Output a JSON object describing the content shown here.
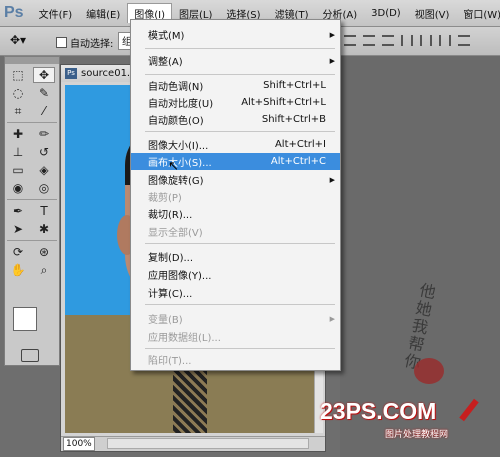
{
  "app": {
    "logo": "Ps"
  },
  "menubar": {
    "items": [
      "文件(F)",
      "编辑(E)",
      "图像(I)",
      "图层(L)",
      "选择(S)",
      "滤镜(T)",
      "分析(A)",
      "3D(D)",
      "视图(V)",
      "窗口(W)"
    ],
    "active": "图像(I)"
  },
  "options": {
    "auto_select_label": "自动选择:",
    "auto_select_value": "组"
  },
  "document": {
    "title": "source01.jp",
    "zoom": "100%"
  },
  "image_menu": {
    "items": [
      {
        "label": "模式(M)",
        "shortcut": "",
        "submenu": true,
        "disabled": false
      },
      {
        "label": "调整(A)",
        "shortcut": "",
        "submenu": true,
        "disabled": false
      },
      {
        "label": "自动色调(N)",
        "shortcut": "Shift+Ctrl+L",
        "submenu": false,
        "disabled": false
      },
      {
        "label": "自动对比度(U)",
        "shortcut": "Alt+Shift+Ctrl+L",
        "submenu": false,
        "disabled": false
      },
      {
        "label": "自动颜色(O)",
        "shortcut": "Shift+Ctrl+B",
        "submenu": false,
        "disabled": false
      },
      {
        "label": "图像大小(I)...",
        "shortcut": "Alt+Ctrl+I",
        "submenu": false,
        "disabled": false
      },
      {
        "label": "画布大小(S)...",
        "shortcut": "Alt+Ctrl+C",
        "submenu": false,
        "disabled": false,
        "highlighted": true
      },
      {
        "label": "图像旋转(G)",
        "shortcut": "",
        "submenu": true,
        "disabled": false
      },
      {
        "label": "裁剪(P)",
        "shortcut": "",
        "submenu": false,
        "disabled": true
      },
      {
        "label": "裁切(R)...",
        "shortcut": "",
        "submenu": false,
        "disabled": false
      },
      {
        "label": "显示全部(V)",
        "shortcut": "",
        "submenu": false,
        "disabled": true
      },
      {
        "label": "复制(D)...",
        "shortcut": "",
        "submenu": false,
        "disabled": false
      },
      {
        "label": "应用图像(Y)...",
        "shortcut": "",
        "submenu": false,
        "disabled": false
      },
      {
        "label": "计算(C)...",
        "shortcut": "",
        "submenu": false,
        "disabled": false
      },
      {
        "label": "变量(B)",
        "shortcut": "",
        "submenu": true,
        "disabled": true
      },
      {
        "label": "应用数据组(L)...",
        "shortcut": "",
        "submenu": false,
        "disabled": true
      },
      {
        "label": "陷印(T)...",
        "shortcut": "",
        "submenu": false,
        "disabled": true
      }
    ]
  },
  "watermark": {
    "brand": "23PS.COM",
    "subtitle": "图片处理教程网",
    "signature": "他她我帮你"
  },
  "colors": {
    "menu_highlight": "#3b8dde",
    "canvas_bg": "#2f9ae0",
    "watermark_red": "#c61f1f"
  }
}
